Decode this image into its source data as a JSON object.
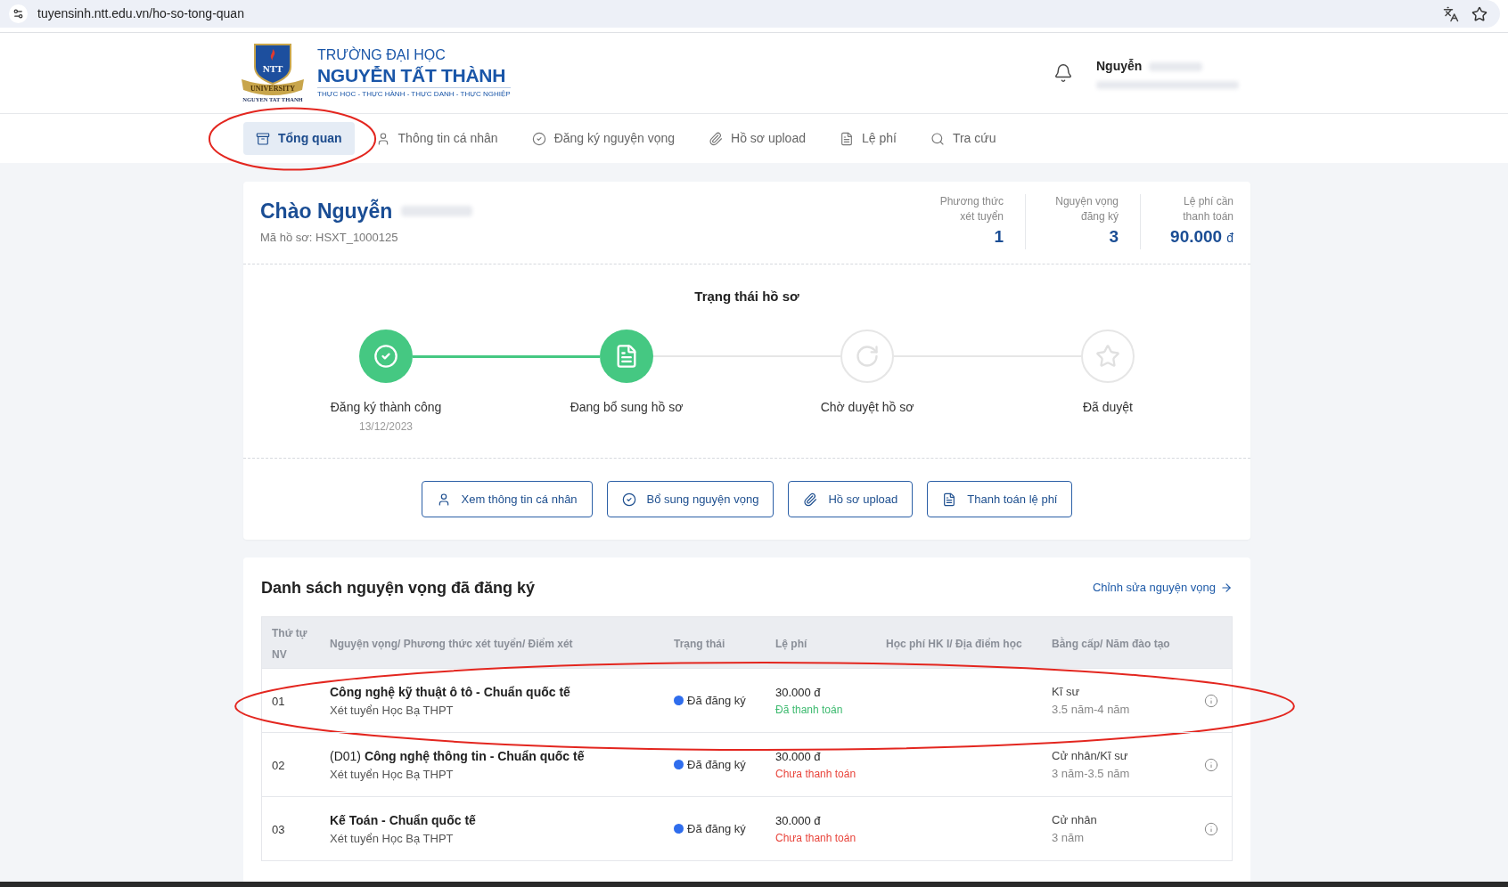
{
  "browser": {
    "url": "tuyensinh.ntt.edu.vn/ho-so-tong-quan"
  },
  "header": {
    "logo": {
      "monogram": "NTT",
      "ribbon": "UNIVERSITY",
      "caption": "NGUYEN TAT THANH"
    },
    "school_line": "TRƯỜNG ĐẠI HỌC",
    "school_name": "NGUYỄN TẤT THÀNH",
    "slogan": "THỰC HỌC - THỰC HÀNH - THỰC DANH - THỰC NGHIỆP",
    "user": {
      "name": "Nguyễn"
    }
  },
  "tabs": [
    {
      "label": "Tổng quan",
      "selected": true,
      "circled": true
    },
    {
      "label": "Thông tin cá nhân",
      "selected": false,
      "circled": false
    },
    {
      "label": "Đăng ký nguyện vọng",
      "selected": false,
      "circled": false
    },
    {
      "label": "Hồ sơ upload",
      "selected": false,
      "circled": false
    },
    {
      "label": "Lệ phí",
      "selected": false,
      "circled": false
    },
    {
      "label": "Tra cứu",
      "selected": false,
      "circled": false
    }
  ],
  "profile": {
    "greeting": "Chào Nguyễn",
    "file_code": "Mã hồ sơ: HSXT_1000125",
    "stats": [
      {
        "label": "Phương thức xét tuyển",
        "value": "1"
      },
      {
        "label": "Nguyện vọng đăng ký",
        "value": "3"
      },
      {
        "label": "Lệ phí cần thanh toán",
        "value": "90.000",
        "unit": "đ"
      }
    ]
  },
  "status": {
    "title": "Trạng thái hồ sơ",
    "steps": [
      {
        "label": "Đăng ký thành công",
        "date": "13/12/2023",
        "reached": true
      },
      {
        "label": "Đang bổ sung hồ sơ",
        "reached": true
      },
      {
        "label": "Chờ duyệt hồ sơ",
        "reached": false
      },
      {
        "label": "Đã duyệt",
        "reached": false
      }
    ]
  },
  "actions": [
    "Xem thông tin cá nhân",
    "Bổ sung nguyện vọng",
    "Hồ sơ upload",
    "Thanh toán lệ phí"
  ],
  "wishlist": {
    "title": "Danh sách nguyện vọng đã đăng ký",
    "edit_link": "Chỉnh sửa nguyện vọng",
    "columns": [
      "Thứ tự NV",
      "Nguyện vọng/ Phương thức xét tuyển/ Điểm xét",
      "Trạng thái",
      "Lệ phí",
      "Học phí HK I/ Địa điểm học",
      "Bằng cấp/ Năm đào tạo"
    ],
    "rows": [
      {
        "rank": "01",
        "title": "Công nghệ kỹ thuật ô tô - Chuẩn quốc tế",
        "method": "Xét tuyển Học Bạ THPT",
        "status": "Đã đăng ký",
        "fee": "30.000 đ",
        "payment": "Đã thanh toán",
        "paid": true,
        "degree": "Kĩ sư",
        "duration": "3.5 năm-4 năm",
        "circled": true
      },
      {
        "rank": "02",
        "code": "(D01)",
        "title": "Công nghệ thông tin - Chuẩn quốc tế",
        "method": "Xét tuyển Học Bạ THPT",
        "status": "Đã đăng ký",
        "fee": "30.000 đ",
        "payment": "Chưa thanh toán",
        "paid": false,
        "degree": "Cử nhân/Kĩ sư",
        "duration": "3 năm-3.5 năm",
        "circled": false
      },
      {
        "rank": "03",
        "title": "Kế Toán - Chuẩn quốc tế",
        "method": "Xét tuyển Học Bạ THPT",
        "status": "Đã đăng ký",
        "fee": "30.000 đ",
        "payment": "Chưa thanh toán",
        "paid": false,
        "degree": "Cử nhân",
        "duration": "3 năm",
        "circled": false
      }
    ]
  }
}
